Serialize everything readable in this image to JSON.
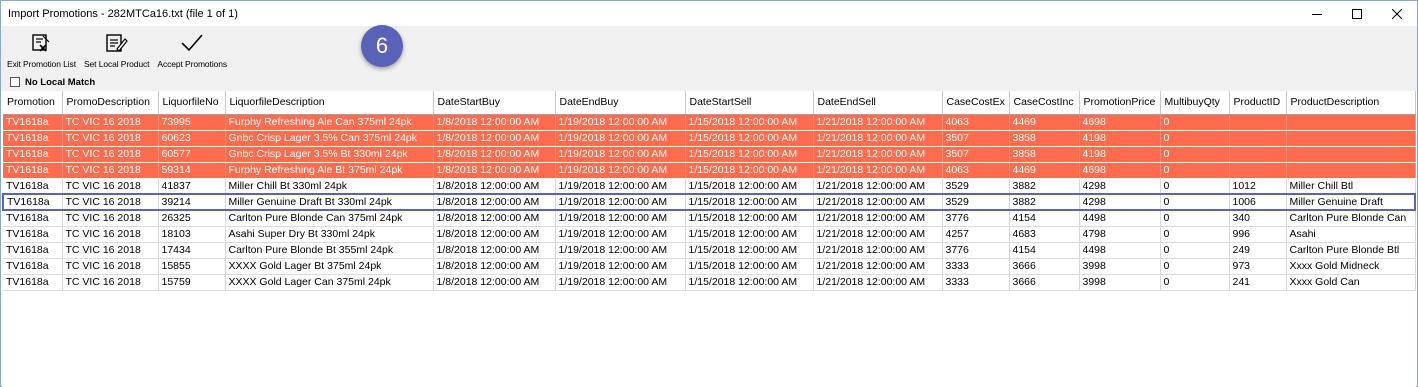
{
  "window": {
    "title": "Import Promotions - 282MTCa16.txt (file 1 of 1)"
  },
  "toolbar": {
    "buttons": [
      {
        "label": "Exit Promotion List",
        "icon": "exit-list-icon"
      },
      {
        "label": "Set Local Product",
        "icon": "edit-document-icon"
      },
      {
        "label": "Accept Promotions",
        "icon": "checkmark-icon"
      }
    ]
  },
  "badge": {
    "text": "6",
    "color": "#5a62b8"
  },
  "filter": {
    "no_local_match_label": "No Local Match"
  },
  "colors": {
    "unmatched_row": "#ff6b4e",
    "selection": "#5a62b8"
  },
  "grid": {
    "columns": [
      "Promotion",
      "PromoDescription",
      "LiquorfileNo",
      "LiquorfileDescription",
      "DateStartBuy",
      "DateEndBuy",
      "DateStartSell",
      "DateEndSell",
      "CaseCostEx",
      "CaseCostInc",
      "PromotionPrice",
      "MultibuyQty",
      "ProductID",
      "ProductDescription"
    ],
    "rows": [
      {
        "status": "unmatched",
        "cells": [
          "TV1618a",
          "TC VIC 16 2018",
          "73995",
          "Furphy Refreshing Ale Can 375ml 24pk",
          "1/8/2018 12:00:00 AM",
          "1/19/2018 12:00:00 AM",
          "1/15/2018 12:00:00 AM",
          "1/21/2018 12:00:00 AM",
          "4063",
          "4469",
          "4698",
          "0",
          "",
          ""
        ]
      },
      {
        "status": "unmatched",
        "cells": [
          "TV1618a",
          "TC VIC 16 2018",
          "60623",
          "Gnbc Crisp Lager 3.5% Can 375ml 24pk",
          "1/8/2018 12:00:00 AM",
          "1/19/2018 12:00:00 AM",
          "1/15/2018 12:00:00 AM",
          "1/21/2018 12:00:00 AM",
          "3507",
          "3858",
          "4198",
          "0",
          "",
          ""
        ]
      },
      {
        "status": "unmatched",
        "cells": [
          "TV1618a",
          "TC VIC 16 2018",
          "60577",
          "Gnbc Crisp Lager 3.5% Bt 330ml 24pk",
          "1/8/2018 12:00:00 AM",
          "1/19/2018 12:00:00 AM",
          "1/15/2018 12:00:00 AM",
          "1/21/2018 12:00:00 AM",
          "3507",
          "3858",
          "4198",
          "0",
          "",
          ""
        ]
      },
      {
        "status": "unmatched",
        "cells": [
          "TV1618a",
          "TC VIC 16 2018",
          "59314",
          "Furphy Refreshing Ale Bt 375ml 24pk",
          "1/8/2018 12:00:00 AM",
          "1/19/2018 12:00:00 AM",
          "1/15/2018 12:00:00 AM",
          "1/21/2018 12:00:00 AM",
          "4063",
          "4469",
          "4698",
          "0",
          "",
          ""
        ]
      },
      {
        "status": "matched",
        "cells": [
          "TV1618a",
          "TC VIC 16 2018",
          "41837",
          "Miller Chill Bt 330ml 24pk",
          "1/8/2018 12:00:00 AM",
          "1/19/2018 12:00:00 AM",
          "1/15/2018 12:00:00 AM",
          "1/21/2018 12:00:00 AM",
          "3529",
          "3882",
          "4298",
          "0",
          "1012",
          "Miller Chill Btl"
        ]
      },
      {
        "status": "selected",
        "cells": [
          "TV1618a",
          "TC VIC 16 2018",
          "39214",
          "Miller Genuine Draft Bt 330ml 24pk",
          "1/8/2018 12:00:00 AM",
          "1/19/2018 12:00:00 AM",
          "1/15/2018 12:00:00 AM",
          "1/21/2018 12:00:00 AM",
          "3529",
          "3882",
          "4298",
          "0",
          "1006",
          "Miller Genuine Draft"
        ]
      },
      {
        "status": "matched",
        "cells": [
          "TV1618a",
          "TC VIC 16 2018",
          "26325",
          "Carlton Pure Blonde Can 375ml 24pk",
          "1/8/2018 12:00:00 AM",
          "1/19/2018 12:00:00 AM",
          "1/15/2018 12:00:00 AM",
          "1/21/2018 12:00:00 AM",
          "3776",
          "4154",
          "4498",
          "0",
          "340",
          "Carlton Pure Blonde Can"
        ]
      },
      {
        "status": "matched",
        "cells": [
          "TV1618a",
          "TC VIC 16 2018",
          "18103",
          "Asahi Super Dry Bt 330ml 24pk",
          "1/8/2018 12:00:00 AM",
          "1/19/2018 12:00:00 AM",
          "1/15/2018 12:00:00 AM",
          "1/21/2018 12:00:00 AM",
          "4257",
          "4683",
          "4798",
          "0",
          "996",
          "Asahi"
        ]
      },
      {
        "status": "matched",
        "cells": [
          "TV1618a",
          "TC VIC 16 2018",
          "17434",
          "Carlton Pure Blonde Bt 355ml 24pk",
          "1/8/2018 12:00:00 AM",
          "1/19/2018 12:00:00 AM",
          "1/15/2018 12:00:00 AM",
          "1/21/2018 12:00:00 AM",
          "3776",
          "4154",
          "4498",
          "0",
          "249",
          "Carlton Pure Blonde Btl"
        ]
      },
      {
        "status": "matched",
        "cells": [
          "TV1618a",
          "TC VIC 16 2018",
          "15855",
          "XXXX Gold Lager Bt 375ml 24pk",
          "1/8/2018 12:00:00 AM",
          "1/19/2018 12:00:00 AM",
          "1/15/2018 12:00:00 AM",
          "1/21/2018 12:00:00 AM",
          "3333",
          "3666",
          "3998",
          "0",
          "973",
          "Xxxx Gold Midneck"
        ]
      },
      {
        "status": "matched",
        "cells": [
          "TV1618a",
          "TC VIC 16 2018",
          "15759",
          "XXXX Gold Lager Can 375ml 24pk",
          "1/8/2018 12:00:00 AM",
          "1/19/2018 12:00:00 AM",
          "1/15/2018 12:00:00 AM",
          "1/21/2018 12:00:00 AM",
          "3333",
          "3666",
          "3998",
          "0",
          "241",
          "Xxxx Gold Can"
        ]
      }
    ]
  }
}
